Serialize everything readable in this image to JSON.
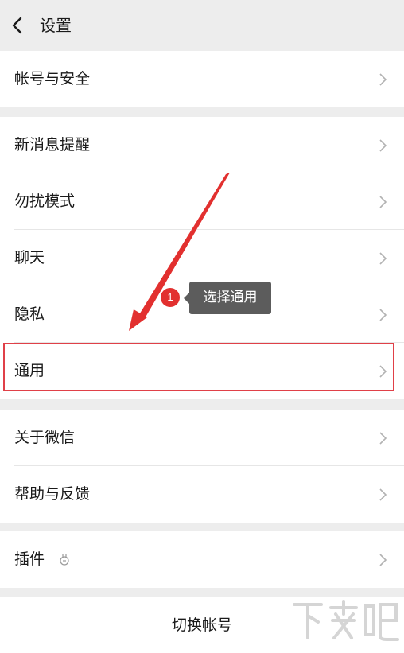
{
  "header": {
    "title": "设置",
    "back_icon": "chevron-left-icon"
  },
  "groups": [
    {
      "items": [
        {
          "label": "帐号与安全"
        }
      ]
    },
    {
      "items": [
        {
          "label": "新消息提醒"
        },
        {
          "label": "勿扰模式"
        },
        {
          "label": "聊天"
        },
        {
          "label": "隐私"
        },
        {
          "label": "通用"
        }
      ]
    },
    {
      "items": [
        {
          "label": "关于微信"
        },
        {
          "label": "帮助与反馈"
        }
      ]
    },
    {
      "items": [
        {
          "label": "插件",
          "icon": "plugin-icon"
        }
      ]
    }
  ],
  "switch_account": {
    "label": "切换帐号"
  },
  "annotation": {
    "step_number": "1",
    "tooltip_text": "选择通用",
    "highlight_color": "#e04048",
    "arrow_color": "#e2302f"
  },
  "watermark": {
    "text": "下载吧"
  },
  "colors": {
    "background": "#ededed",
    "row_background": "#ffffff",
    "text": "#1a1a1a",
    "chevron": "#b2b2b2"
  }
}
